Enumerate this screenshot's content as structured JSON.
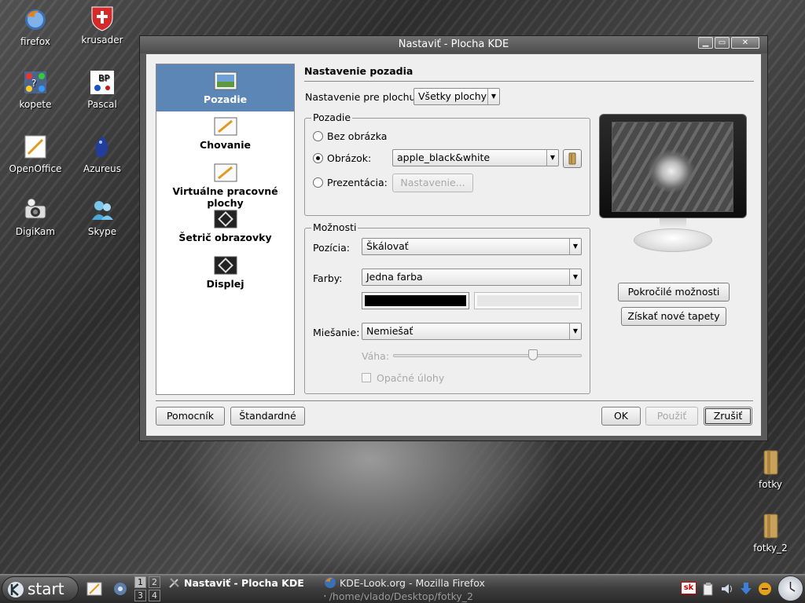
{
  "desktop": {
    "icons": [
      {
        "label": "firefox"
      },
      {
        "label": "krusader"
      },
      {
        "label": "kopete"
      },
      {
        "label": "Pascal"
      },
      {
        "label": "OpenOffice"
      },
      {
        "label": "Azureus"
      },
      {
        "label": "DigiKam"
      },
      {
        "label": "Skype"
      },
      {
        "label": "fotky"
      },
      {
        "label": "fotky_2"
      }
    ]
  },
  "window": {
    "title": "Nastaviť - Plocha KDE",
    "titlebar_buttons": {
      "minimize": "▁",
      "maximize": "▭",
      "close": "✕"
    }
  },
  "nav": {
    "items": [
      {
        "label": "Pozadie",
        "active": true
      },
      {
        "label": "Chovanie"
      },
      {
        "label": "Virtuálne pracovné plochy"
      },
      {
        "label": "Šetrič obrazovky"
      },
      {
        "label": "Displej"
      }
    ]
  },
  "page": {
    "title": "Nastavenie pozadia",
    "desktop_selector_label": "Nastavenie pre plochu:",
    "desktop_selector_value": "Všetky plochy"
  },
  "background_group": {
    "title": "Pozadie",
    "no_image_label": "Bez obrázka",
    "image_label": "Obrázok:",
    "image_value": "apple_black&white",
    "slideshow_label": "Prezentácia:",
    "slideshow_settings_button": "Nastavenie..."
  },
  "options_group": {
    "title": "Možnosti",
    "position_label": "Pozícia:",
    "position_value": "Škálovať",
    "colors_label": "Farby:",
    "colors_value": "Jedna farba",
    "primary_color": "#000000",
    "secondary_color": "#e6e6e6",
    "blending_label": "Miešanie:",
    "blending_value": "Nemiešať",
    "balance_label": "Váha:",
    "balance_level_percent": 74,
    "reverse_roles_label": "Opačné úlohy"
  },
  "preview": {
    "advanced_button": "Pokročilé možnosti",
    "get_wallpapers_button": "Získať nové tapety"
  },
  "footer": {
    "help_button": "Pomocník",
    "defaults_button": "Štandardné",
    "ok_button": "OK",
    "apply_button": "Použiť",
    "cancel_button": "Zrušiť"
  },
  "taskbar": {
    "start_label": "start",
    "pager": [
      "1",
      "2",
      "3",
      "4"
    ],
    "tasks": [
      {
        "label": "Nastaviť - Plocha KDE"
      },
      {
        "label": "KDE-Look.org - Mozilla Firefox"
      },
      {
        "label": "/home/vlado/Desktop/fotky_2"
      }
    ],
    "keyboard_layout": "sk"
  },
  "colors": {
    "nav_active": "#5b86b6",
    "window_bg": "#efefef",
    "titlebar": "#5a5a5a"
  }
}
